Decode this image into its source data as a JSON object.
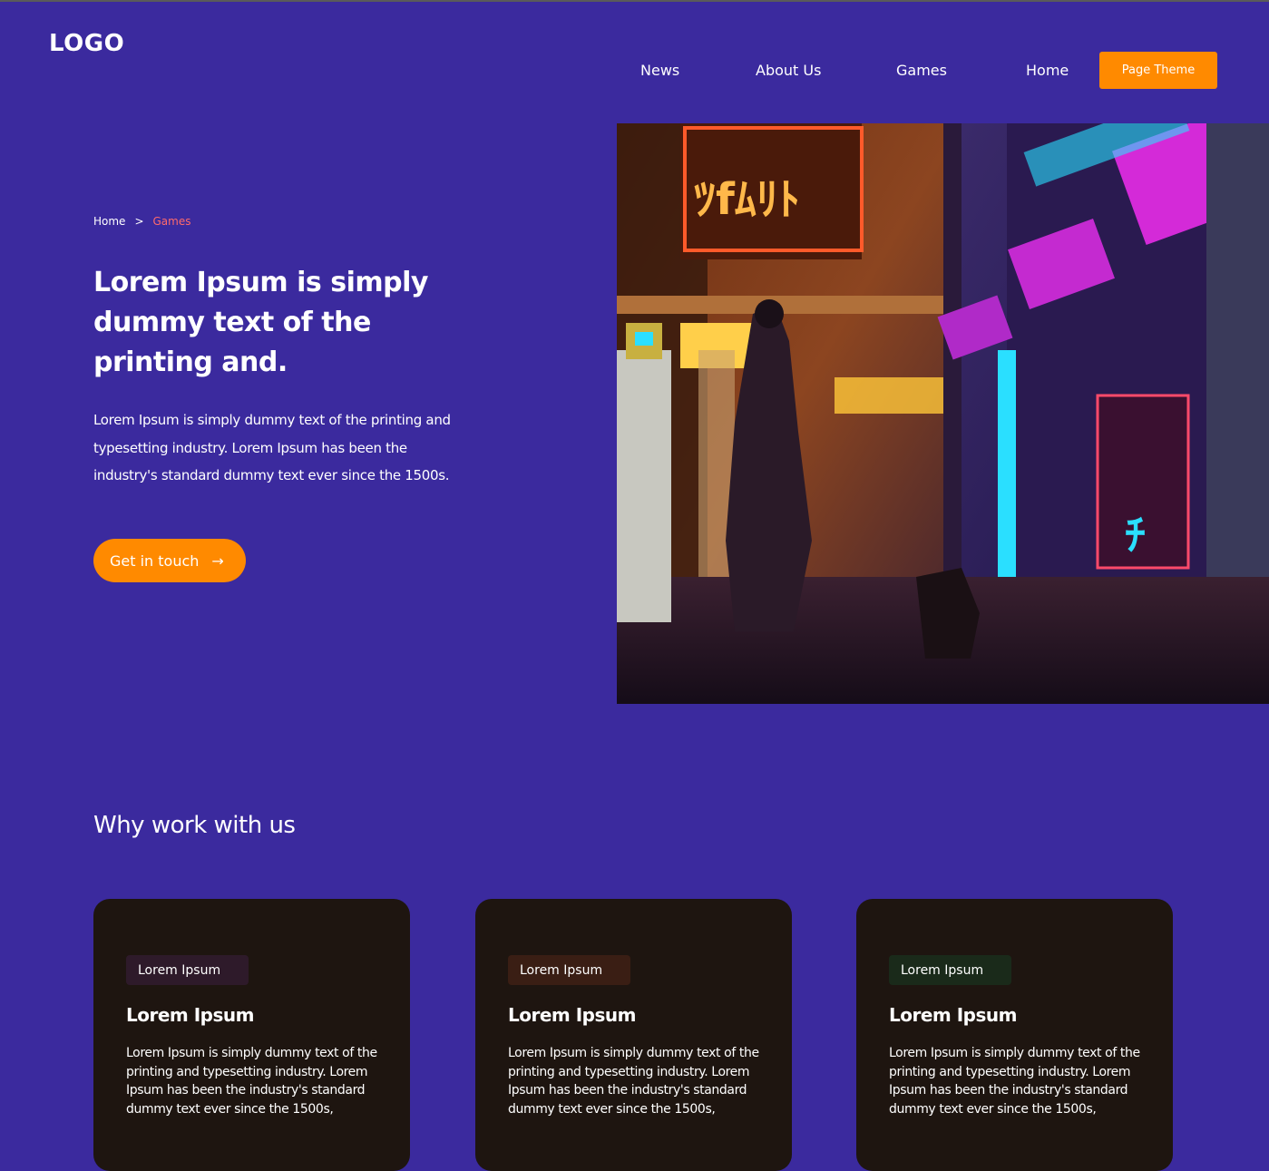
{
  "header": {
    "logo": "LOGO",
    "nav": [
      "News",
      "About Us",
      "Games",
      "Home"
    ],
    "theme_button": "Page Theme"
  },
  "hero": {
    "breadcrumb": {
      "home": "Home",
      "separator": ">",
      "current": "Games"
    },
    "title": "Lorem Ipsum is simply dummy text of the printing and.",
    "text": "Lorem Ipsum is simply dummy text of the printing and typesetting industry. Lorem Ipsum has been the industry's standard dummy text ever since the 1500s.",
    "cta_label": "Get in touch",
    "cta_icon": "arrow-right-icon"
  },
  "why": {
    "title": "Why work with us",
    "cards": [
      {
        "tag": "Lorem Ipsum",
        "tag_color": "#2e1a2a",
        "title": "Lorem Ipsum",
        "text": "Lorem Ipsum is simply dummy text of the printing and typesetting industry. Lorem Ipsum has been the industry's standard dummy text ever since the 1500s,"
      },
      {
        "tag": "Lorem Ipsum",
        "tag_color": "#3a1e14",
        "title": "Lorem Ipsum",
        "text": "Lorem Ipsum is simply dummy text of the printing and typesetting industry. Lorem Ipsum has been the industry's standard dummy text ever since the 1500s,"
      },
      {
        "tag": "Lorem Ipsum",
        "tag_color": "#1a2a1a",
        "title": "Lorem Ipsum",
        "text": "Lorem Ipsum is simply dummy text of the printing and typesetting industry. Lorem Ipsum has been the industry's standard dummy text ever since the 1500s,"
      }
    ]
  },
  "colors": {
    "background": "#3b2a9e",
    "accent": "#ff8a00",
    "card": "#1e1510",
    "breadcrumb_active": "#ff6b6b"
  }
}
